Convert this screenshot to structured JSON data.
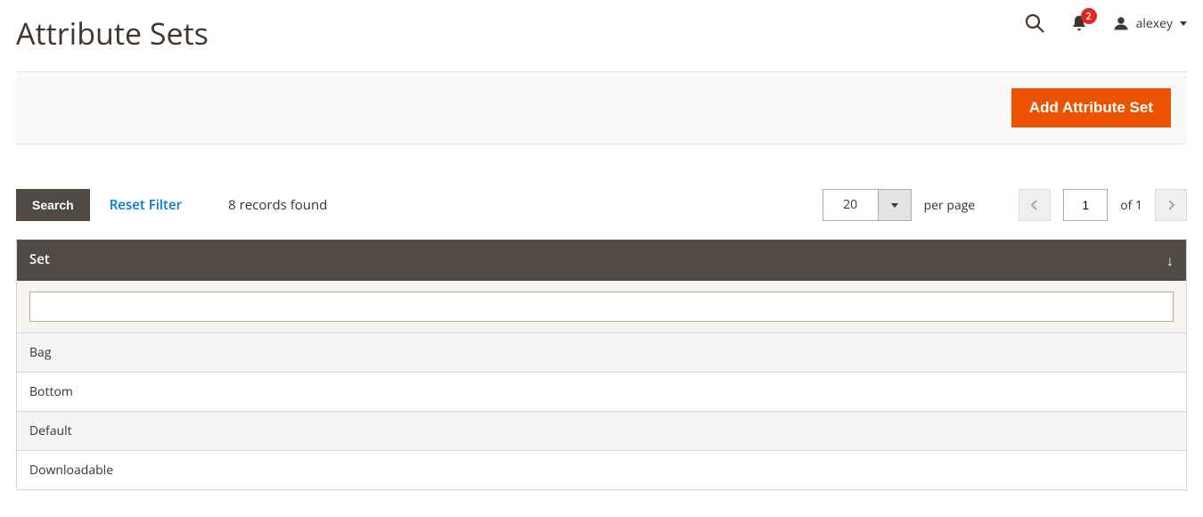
{
  "header": {
    "title": "Attribute Sets",
    "notification_count": "2",
    "username": "alexey"
  },
  "action_bar": {
    "add_button_label": "Add Attribute Set"
  },
  "grid_controls": {
    "search_label": "Search",
    "reset_label": "Reset Filter",
    "records_found": "8 records found",
    "per_page_value": "20",
    "per_page_label": "per page",
    "current_page": "1",
    "of_total": "of 1"
  },
  "table": {
    "column_header": "Set",
    "filter_value": "",
    "rows": [
      "Bag",
      "Bottom",
      "Default",
      "Downloadable"
    ]
  }
}
